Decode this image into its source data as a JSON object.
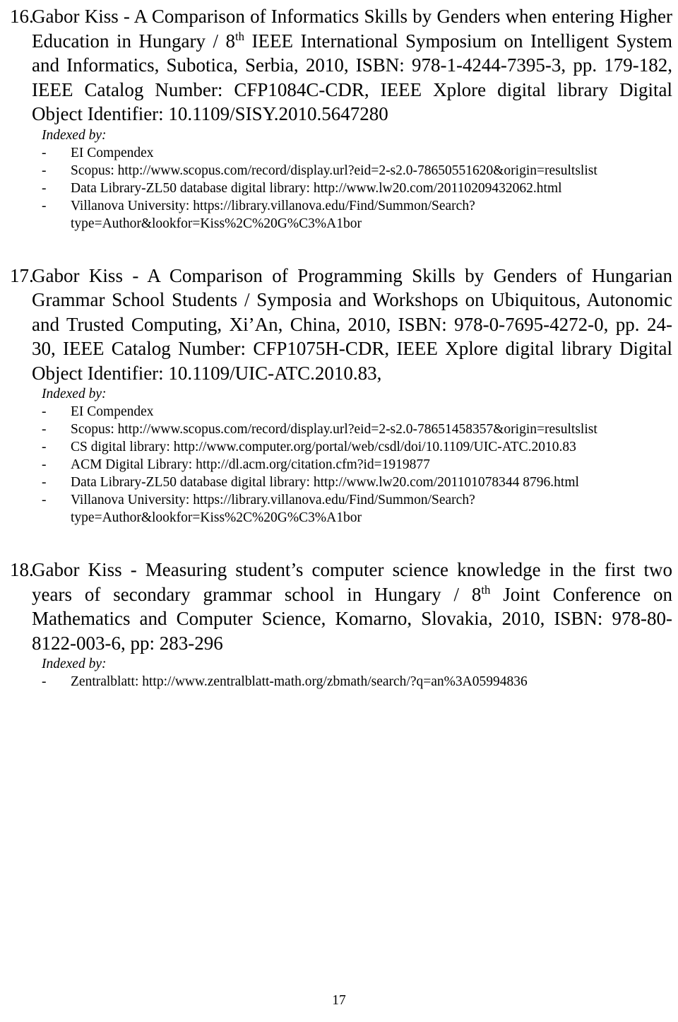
{
  "document": {
    "page_number": "17",
    "indexed_by_label": "Indexed by:",
    "dash_bullet": "-"
  },
  "entries": [
    {
      "number": "16.",
      "citation_before_sup": "Gabor Kiss - A Comparison of Informatics Skills by Genders when entering Higher Education in Hungary / 8",
      "citation_sup": "th",
      "citation_after_sup": " IEEE International Symposium on Intelligent System and Informatics, Subotica, Serbia, 2010, ISBN: 978-1-4244-7395-3, pp. 179-182, IEEE Catalog Number: CFP1084C-CDR, IEEE Xplore digital library Digital Object Identifier: 10.1109/SISY.2010.5647280",
      "indexed_by": [
        "EI Compendex",
        "Scopus: http://www.scopus.com/record/display.url?eid=2-s2.0-78650551620&origin=resultslist",
        "Data Library-ZL50 database digital library: http://www.lw20.com/20110209432062.html",
        "Villanova University: https://library.villanova.edu/Find/Summon/Search?type=Author&lookfor=Kiss%2C%20G%C3%A1bor"
      ]
    },
    {
      "number": "17.",
      "citation_before_sup": "Gabor Kiss - A Comparison of Programming Skills by Genders of Hungarian Grammar School Students / Symposia and Workshops on Ubiquitous, Autonomic and Trusted Computing, Xi’An, China, 2010, ISBN: 978-0-7695-4272-0, pp. 24-30, IEEE Catalog Number: CFP1075H-CDR, IEEE Xplore digital library Digital Object Identifier: 10.1109/UIC-ATC.2010.83,",
      "citation_sup": "",
      "citation_after_sup": "",
      "indexed_by": [
        "EI Compendex",
        "Scopus: http://www.scopus.com/record/display.url?eid=2-s2.0-78651458357&origin=resultslist",
        "CS digital library: http://www.computer.org/portal/web/csdl/doi/10.1109/UIC-ATC.2010.83",
        "ACM Digital Library: http://dl.acm.org/citation.cfm?id=1919877",
        "Data Library-ZL50 database digital library: http://www.lw20.com/201101078344 8796.html",
        "Villanova University: https://library.villanova.edu/Find/Summon/Search?type=Author&lookfor=Kiss%2C%20G%C3%A1bor"
      ]
    },
    {
      "number": "18.",
      "citation_before_sup": "Gabor Kiss - Measuring student’s computer science knowledge in the first two years of secondary grammar school in Hungary / 8",
      "citation_sup": "th",
      "citation_after_sup": " Joint Conference on Mathematics and Computer Science, Komarno, Slovakia, 2010, ISBN: 978-80-8122-003-6, pp: 283-296",
      "indexed_by": [
        "Zentralblatt: http://www.zentralblatt-math.org/zbmath/search/?q=an%3A05994836"
      ]
    }
  ]
}
